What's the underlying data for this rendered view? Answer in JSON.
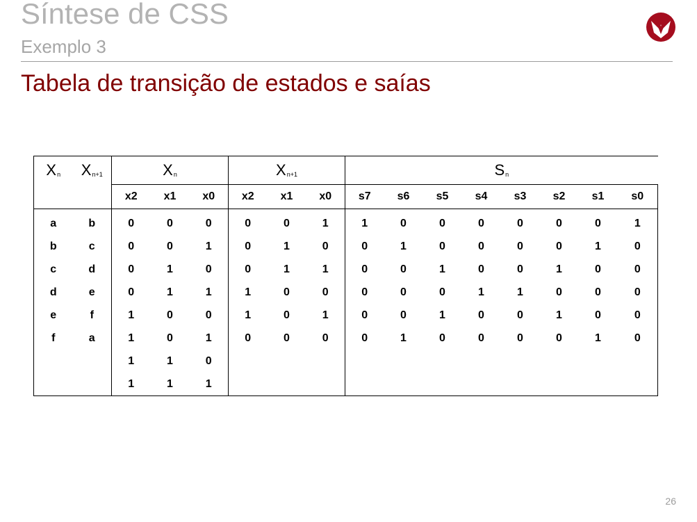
{
  "slide": {
    "title": "Síntese de CSS",
    "subtitle": "Exemplo 3",
    "heading": "Tabela de transição de estados e saías",
    "page_number": "26",
    "logo_icon": "university-logo-icon",
    "colors": {
      "heading": "#800000",
      "title": "#b3b3b3",
      "logo": "#a50d1e"
    }
  },
  "table": {
    "group_headers": [
      {
        "main": "X",
        "sub": "n"
      },
      {
        "main": "X",
        "sub": "n+1"
      },
      {
        "main": "X",
        "sub": "n"
      },
      {
        "main": "X",
        "sub": "n+1"
      },
      {
        "main": "S",
        "sub": "n"
      }
    ],
    "bit_headers_x": [
      "x2",
      "x1",
      "x0"
    ],
    "bit_headers_s": [
      "s7",
      "s6",
      "s5",
      "s4",
      "s3",
      "s2",
      "s1",
      "s0"
    ],
    "rows": [
      {
        "xn": "a",
        "xn1": "b",
        "xbits": [
          "0",
          "0",
          "0"
        ],
        "nbits": [
          "0",
          "0",
          "1"
        ],
        "sbits": [
          "1",
          "0",
          "0",
          "0",
          "0",
          "0",
          "0",
          "1"
        ]
      },
      {
        "xn": "b",
        "xn1": "c",
        "xbits": [
          "0",
          "0",
          "1"
        ],
        "nbits": [
          "0",
          "1",
          "0"
        ],
        "sbits": [
          "0",
          "1",
          "0",
          "0",
          "0",
          "0",
          "1",
          "0"
        ]
      },
      {
        "xn": "c",
        "xn1": "d",
        "xbits": [
          "0",
          "1",
          "0"
        ],
        "nbits": [
          "0",
          "1",
          "1"
        ],
        "sbits": [
          "0",
          "0",
          "1",
          "0",
          "0",
          "1",
          "0",
          "0"
        ]
      },
      {
        "xn": "d",
        "xn1": "e",
        "xbits": [
          "0",
          "1",
          "1"
        ],
        "nbits": [
          "1",
          "0",
          "0"
        ],
        "sbits": [
          "0",
          "0",
          "0",
          "1",
          "1",
          "0",
          "0",
          "0"
        ]
      },
      {
        "xn": "e",
        "xn1": "f",
        "xbits": [
          "1",
          "0",
          "0"
        ],
        "nbits": [
          "1",
          "0",
          "1"
        ],
        "sbits": [
          "0",
          "0",
          "1",
          "0",
          "0",
          "1",
          "0",
          "0"
        ]
      },
      {
        "xn": "f",
        "xn1": "a",
        "xbits": [
          "1",
          "0",
          "1"
        ],
        "nbits": [
          "0",
          "0",
          "0"
        ],
        "sbits": [
          "0",
          "1",
          "0",
          "0",
          "0",
          "0",
          "1",
          "0"
        ]
      },
      {
        "xn": "",
        "xn1": "",
        "xbits": [
          "1",
          "1",
          "0"
        ],
        "nbits": [
          "",
          "",
          ""
        ],
        "sbits": [
          "",
          "",
          "",
          "",
          "",
          "",
          "",
          ""
        ]
      },
      {
        "xn": "",
        "xn1": "",
        "xbits": [
          "1",
          "1",
          "1"
        ],
        "nbits": [
          "",
          "",
          ""
        ],
        "sbits": [
          "",
          "",
          "",
          "",
          "",
          "",
          "",
          ""
        ]
      }
    ]
  }
}
